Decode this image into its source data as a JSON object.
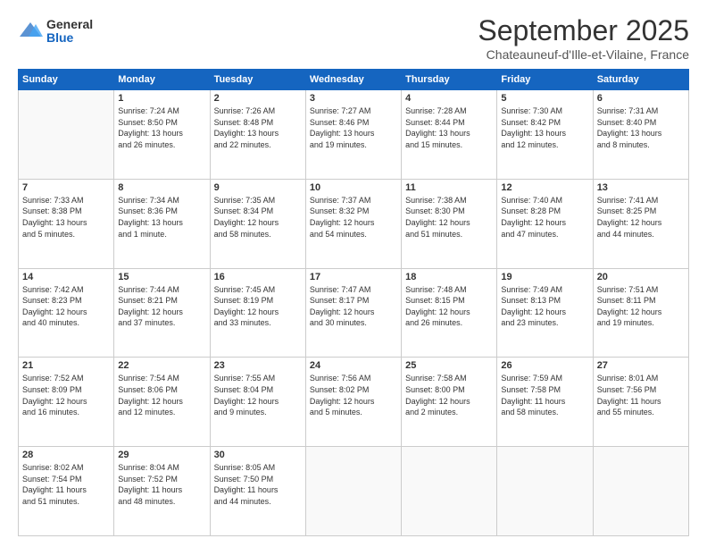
{
  "logo": {
    "general": "General",
    "blue": "Blue"
  },
  "header": {
    "month": "September 2025",
    "location": "Chateauneuf-d'Ille-et-Vilaine, France"
  },
  "weekdays": [
    "Sunday",
    "Monday",
    "Tuesday",
    "Wednesday",
    "Thursday",
    "Friday",
    "Saturday"
  ],
  "weeks": [
    [
      {
        "day": "",
        "info": ""
      },
      {
        "day": "1",
        "info": "Sunrise: 7:24 AM\nSunset: 8:50 PM\nDaylight: 13 hours\nand 26 minutes."
      },
      {
        "day": "2",
        "info": "Sunrise: 7:26 AM\nSunset: 8:48 PM\nDaylight: 13 hours\nand 22 minutes."
      },
      {
        "day": "3",
        "info": "Sunrise: 7:27 AM\nSunset: 8:46 PM\nDaylight: 13 hours\nand 19 minutes."
      },
      {
        "day": "4",
        "info": "Sunrise: 7:28 AM\nSunset: 8:44 PM\nDaylight: 13 hours\nand 15 minutes."
      },
      {
        "day": "5",
        "info": "Sunrise: 7:30 AM\nSunset: 8:42 PM\nDaylight: 13 hours\nand 12 minutes."
      },
      {
        "day": "6",
        "info": "Sunrise: 7:31 AM\nSunset: 8:40 PM\nDaylight: 13 hours\nand 8 minutes."
      }
    ],
    [
      {
        "day": "7",
        "info": "Sunrise: 7:33 AM\nSunset: 8:38 PM\nDaylight: 13 hours\nand 5 minutes."
      },
      {
        "day": "8",
        "info": "Sunrise: 7:34 AM\nSunset: 8:36 PM\nDaylight: 13 hours\nand 1 minute."
      },
      {
        "day": "9",
        "info": "Sunrise: 7:35 AM\nSunset: 8:34 PM\nDaylight: 12 hours\nand 58 minutes."
      },
      {
        "day": "10",
        "info": "Sunrise: 7:37 AM\nSunset: 8:32 PM\nDaylight: 12 hours\nand 54 minutes."
      },
      {
        "day": "11",
        "info": "Sunrise: 7:38 AM\nSunset: 8:30 PM\nDaylight: 12 hours\nand 51 minutes."
      },
      {
        "day": "12",
        "info": "Sunrise: 7:40 AM\nSunset: 8:28 PM\nDaylight: 12 hours\nand 47 minutes."
      },
      {
        "day": "13",
        "info": "Sunrise: 7:41 AM\nSunset: 8:25 PM\nDaylight: 12 hours\nand 44 minutes."
      }
    ],
    [
      {
        "day": "14",
        "info": "Sunrise: 7:42 AM\nSunset: 8:23 PM\nDaylight: 12 hours\nand 40 minutes."
      },
      {
        "day": "15",
        "info": "Sunrise: 7:44 AM\nSunset: 8:21 PM\nDaylight: 12 hours\nand 37 minutes."
      },
      {
        "day": "16",
        "info": "Sunrise: 7:45 AM\nSunset: 8:19 PM\nDaylight: 12 hours\nand 33 minutes."
      },
      {
        "day": "17",
        "info": "Sunrise: 7:47 AM\nSunset: 8:17 PM\nDaylight: 12 hours\nand 30 minutes."
      },
      {
        "day": "18",
        "info": "Sunrise: 7:48 AM\nSunset: 8:15 PM\nDaylight: 12 hours\nand 26 minutes."
      },
      {
        "day": "19",
        "info": "Sunrise: 7:49 AM\nSunset: 8:13 PM\nDaylight: 12 hours\nand 23 minutes."
      },
      {
        "day": "20",
        "info": "Sunrise: 7:51 AM\nSunset: 8:11 PM\nDaylight: 12 hours\nand 19 minutes."
      }
    ],
    [
      {
        "day": "21",
        "info": "Sunrise: 7:52 AM\nSunset: 8:09 PM\nDaylight: 12 hours\nand 16 minutes."
      },
      {
        "day": "22",
        "info": "Sunrise: 7:54 AM\nSunset: 8:06 PM\nDaylight: 12 hours\nand 12 minutes."
      },
      {
        "day": "23",
        "info": "Sunrise: 7:55 AM\nSunset: 8:04 PM\nDaylight: 12 hours\nand 9 minutes."
      },
      {
        "day": "24",
        "info": "Sunrise: 7:56 AM\nSunset: 8:02 PM\nDaylight: 12 hours\nand 5 minutes."
      },
      {
        "day": "25",
        "info": "Sunrise: 7:58 AM\nSunset: 8:00 PM\nDaylight: 12 hours\nand 2 minutes."
      },
      {
        "day": "26",
        "info": "Sunrise: 7:59 AM\nSunset: 7:58 PM\nDaylight: 11 hours\nand 58 minutes."
      },
      {
        "day": "27",
        "info": "Sunrise: 8:01 AM\nSunset: 7:56 PM\nDaylight: 11 hours\nand 55 minutes."
      }
    ],
    [
      {
        "day": "28",
        "info": "Sunrise: 8:02 AM\nSunset: 7:54 PM\nDaylight: 11 hours\nand 51 minutes."
      },
      {
        "day": "29",
        "info": "Sunrise: 8:04 AM\nSunset: 7:52 PM\nDaylight: 11 hours\nand 48 minutes."
      },
      {
        "day": "30",
        "info": "Sunrise: 8:05 AM\nSunset: 7:50 PM\nDaylight: 11 hours\nand 44 minutes."
      },
      {
        "day": "",
        "info": ""
      },
      {
        "day": "",
        "info": ""
      },
      {
        "day": "",
        "info": ""
      },
      {
        "day": "",
        "info": ""
      }
    ]
  ]
}
